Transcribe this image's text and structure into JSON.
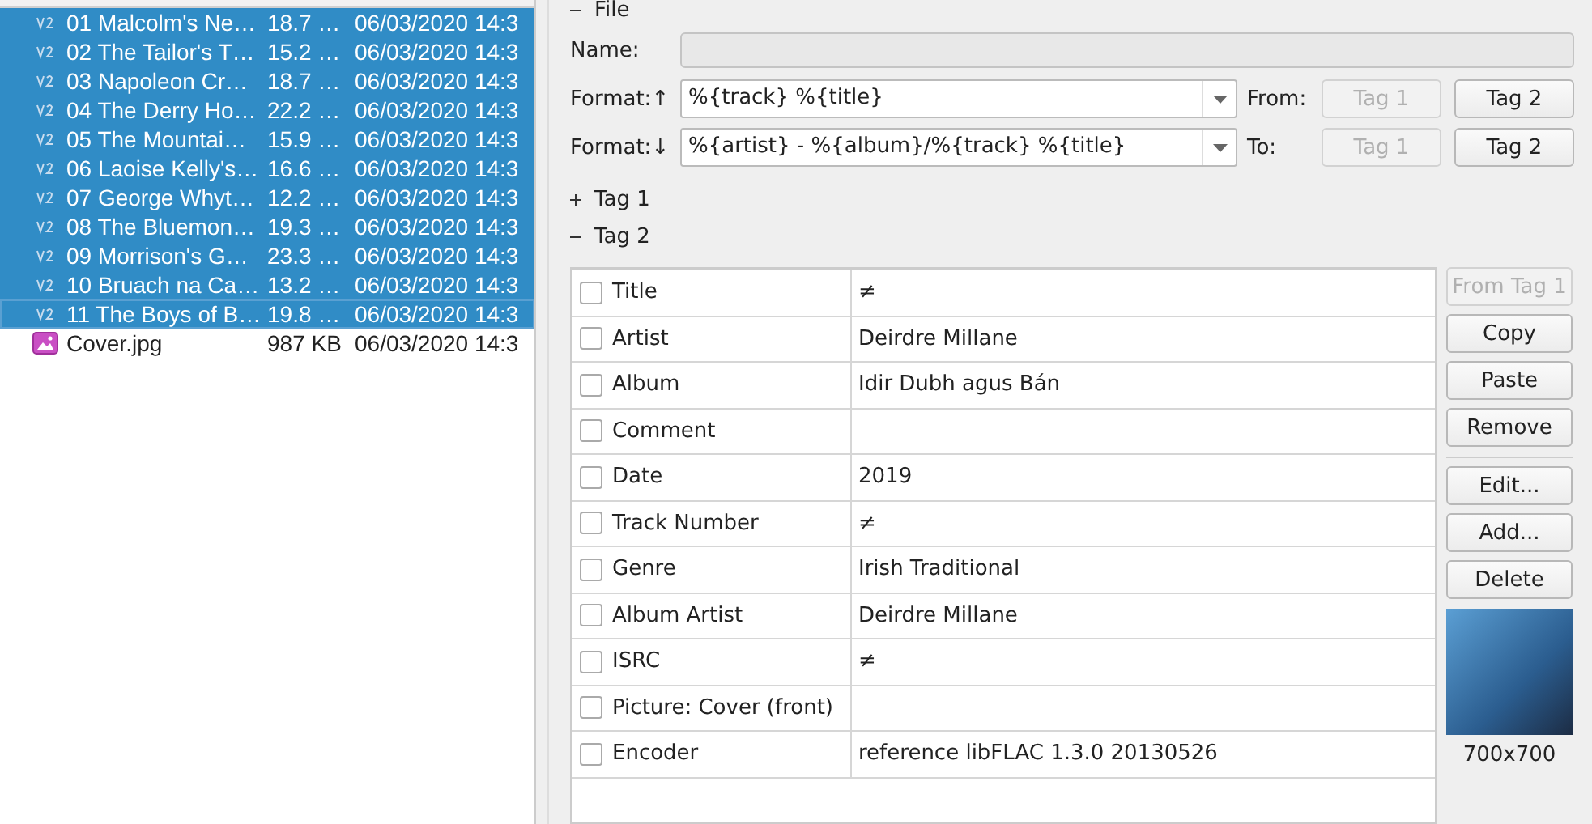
{
  "files": [
    {
      "name": "01 Malcolm's Ne…",
      "size": "18.7 …",
      "modified": "06/03/2020 14:3",
      "kind": "audio",
      "selected": true,
      "focused": false
    },
    {
      "name": "02 The Tailor's T…",
      "size": "15.2 …",
      "modified": "06/03/2020 14:3",
      "kind": "audio",
      "selected": true,
      "focused": false
    },
    {
      "name": "03 Napoleon Cr…",
      "size": "18.7 …",
      "modified": "06/03/2020 14:3",
      "kind": "audio",
      "selected": true,
      "focused": false
    },
    {
      "name": "04 The Derry Ho…",
      "size": "22.2 …",
      "modified": "06/03/2020 14:3",
      "kind": "audio",
      "selected": true,
      "focused": false
    },
    {
      "name": "05 The Mountai…",
      "size": "15.9 …",
      "modified": "06/03/2020 14:3",
      "kind": "audio",
      "selected": true,
      "focused": false
    },
    {
      "name": "06 Laoise Kelly's…",
      "size": "16.6 …",
      "modified": "06/03/2020 14:3",
      "kind": "audio",
      "selected": true,
      "focused": false
    },
    {
      "name": "07 George Whyt…",
      "size": "12.2 …",
      "modified": "06/03/2020 14:3",
      "kind": "audio",
      "selected": true,
      "focused": false
    },
    {
      "name": "08 The Bluemon…",
      "size": "19.3 …",
      "modified": "06/03/2020 14:3",
      "kind": "audio",
      "selected": true,
      "focused": false
    },
    {
      "name": "09 Morrison's  G…",
      "size": "23.3 …",
      "modified": "06/03/2020 14:3",
      "kind": "audio",
      "selected": true,
      "focused": false
    },
    {
      "name": "10 Bruach na Ca…",
      "size": "13.2 …",
      "modified": "06/03/2020 14:3",
      "kind": "audio",
      "selected": true,
      "focused": false
    },
    {
      "name": "11 The Boys of B…",
      "size": "19.8 …",
      "modified": "06/03/2020 14:3",
      "kind": "audio",
      "selected": true,
      "focused": true
    },
    {
      "name": "Cover.jpg",
      "size": "987 KB",
      "modified": "06/03/2020 14:3",
      "kind": "image",
      "selected": false,
      "focused": false
    }
  ],
  "file_section": {
    "label": "File",
    "expanded": true
  },
  "name_field": {
    "label": "Name:"
  },
  "format_up": {
    "label": "Format:↑",
    "value": "%{track} %{title}",
    "side_label": "From:",
    "buttons": [
      {
        "label": "Tag 1",
        "disabled": true
      },
      {
        "label": "Tag 2",
        "disabled": false
      }
    ]
  },
  "format_down": {
    "label": "Format:↓",
    "value": "%{artist} - %{album}/%{track} %{title}",
    "side_label": "To:",
    "buttons": [
      {
        "label": "Tag 1",
        "disabled": true
      },
      {
        "label": "Tag 2",
        "disabled": false
      }
    ]
  },
  "tag_sections": [
    {
      "label": "Tag 1",
      "expanded": false
    },
    {
      "label": "Tag 2",
      "expanded": true
    }
  ],
  "frames": [
    {
      "field": "Title",
      "value": "≠",
      "checked": false
    },
    {
      "field": "Artist",
      "value": "Deirdre Millane",
      "checked": false
    },
    {
      "field": "Album",
      "value": "Idir Dubh agus Bán",
      "checked": false
    },
    {
      "field": "Comment",
      "checked": false
    },
    {
      "field": "Date",
      "value": "2019",
      "checked": false
    },
    {
      "field": "Track Number",
      "value": "≠",
      "checked": false
    },
    {
      "field": "Genre",
      "value": "Irish Traditional",
      "checked": false
    },
    {
      "field": "Album Artist",
      "value": "Deirdre Millane",
      "checked": false
    },
    {
      "field": "ISRC",
      "value": "≠",
      "checked": false
    },
    {
      "field": "Picture: Cover (front)",
      "checked": false
    },
    {
      "field": "Encoder",
      "value": "reference libFLAC 1.3.0 20130526",
      "checked": false
    }
  ],
  "side_buttons": [
    {
      "label": "From Tag 1",
      "disabled": true,
      "kind": "button"
    },
    {
      "label": "Copy",
      "disabled": false,
      "kind": "button"
    },
    {
      "label": "Paste",
      "disabled": false,
      "kind": "button"
    },
    {
      "label": "Remove",
      "disabled": false,
      "kind": "button"
    },
    {
      "kind": "separator"
    },
    {
      "label": "Edit...",
      "disabled": false,
      "kind": "button"
    },
    {
      "label": "Add...",
      "disabled": false,
      "kind": "button"
    },
    {
      "label": "Delete",
      "disabled": false,
      "kind": "button"
    }
  ],
  "cover": {
    "size": "700x700"
  }
}
